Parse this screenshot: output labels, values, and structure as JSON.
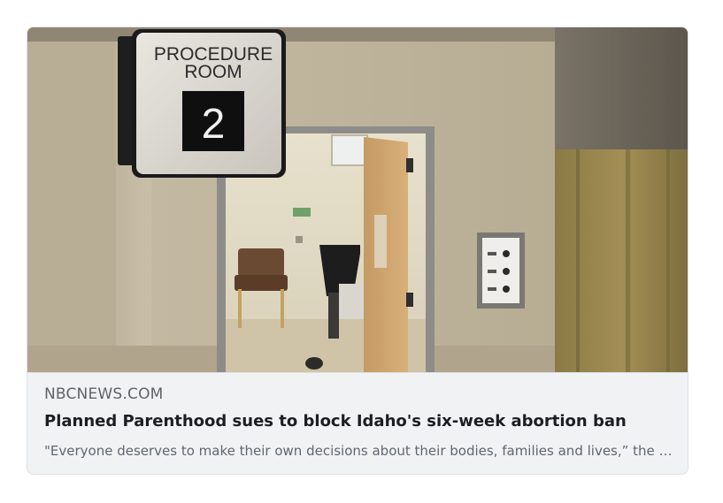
{
  "link_preview": {
    "image": {
      "sign_line1": "PROCEDURE",
      "sign_line2": "ROOM",
      "sign_number": "2"
    },
    "domain": "NBCNEWS.COM",
    "title": "Planned Parenthood sues to block Idaho's six-week abortion ban",
    "description": "\"Everyone deserves to make their own decisions about their bodies, families and lives,” the organization said in a statement."
  }
}
